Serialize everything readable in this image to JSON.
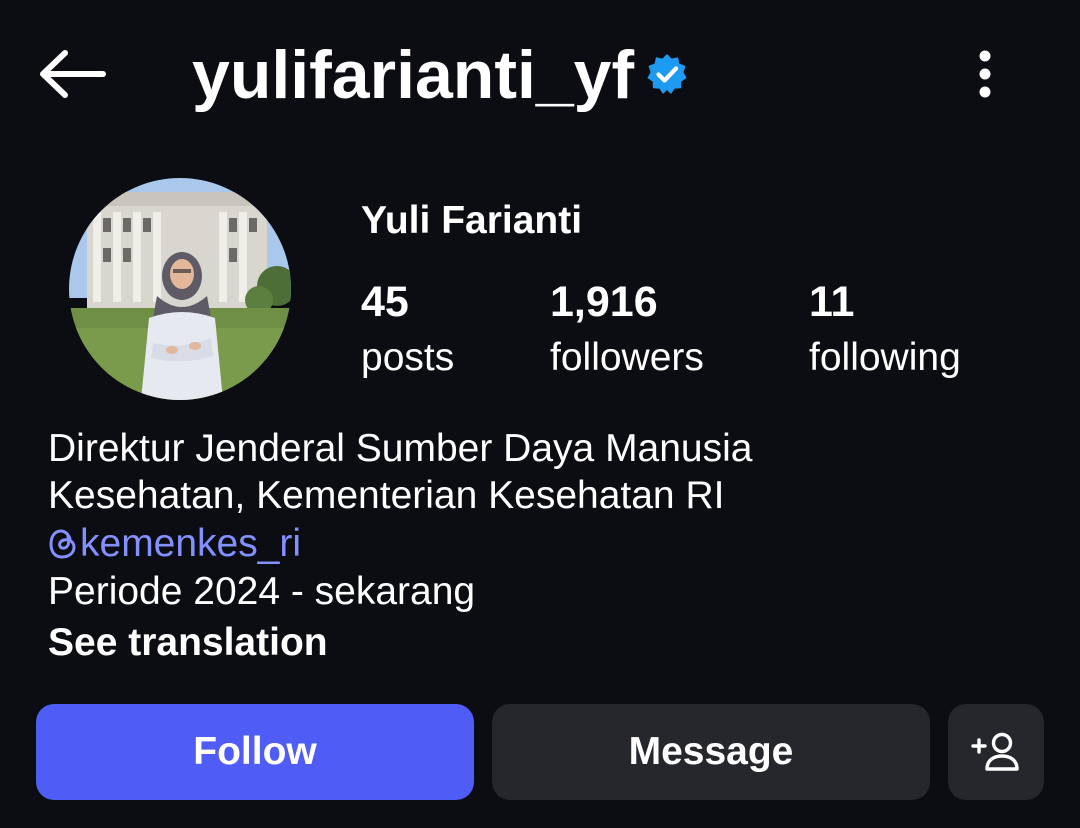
{
  "header": {
    "username": "yulifarianti_yf",
    "verified": true,
    "back_icon": "arrow-left-icon",
    "more_icon": "more-vertical-icon"
  },
  "profile": {
    "display_name": "Yuli Farianti",
    "stats": {
      "posts": {
        "count": "45",
        "label": "posts"
      },
      "followers": {
        "count": "1,916",
        "label": "followers"
      },
      "following": {
        "count": "11",
        "label": "following"
      }
    }
  },
  "bio": {
    "line1": "Direktur Jenderal Sumber Daya Manusia",
    "line2": "Kesehatan, Kementerian Kesehatan RI",
    "threads_handle": "kemenkes_ri",
    "line4": "Periode 2024 - sekarang",
    "see_translation": "See translation"
  },
  "actions": {
    "follow_label": "Follow",
    "message_label": "Message",
    "suggest_icon": "add-person-icon"
  },
  "colors": {
    "background": "#0b0d12",
    "accent": "#4f5cf6",
    "link": "#8590ff",
    "verified": "#1d9bf0",
    "secondary_button": "#25272d"
  }
}
